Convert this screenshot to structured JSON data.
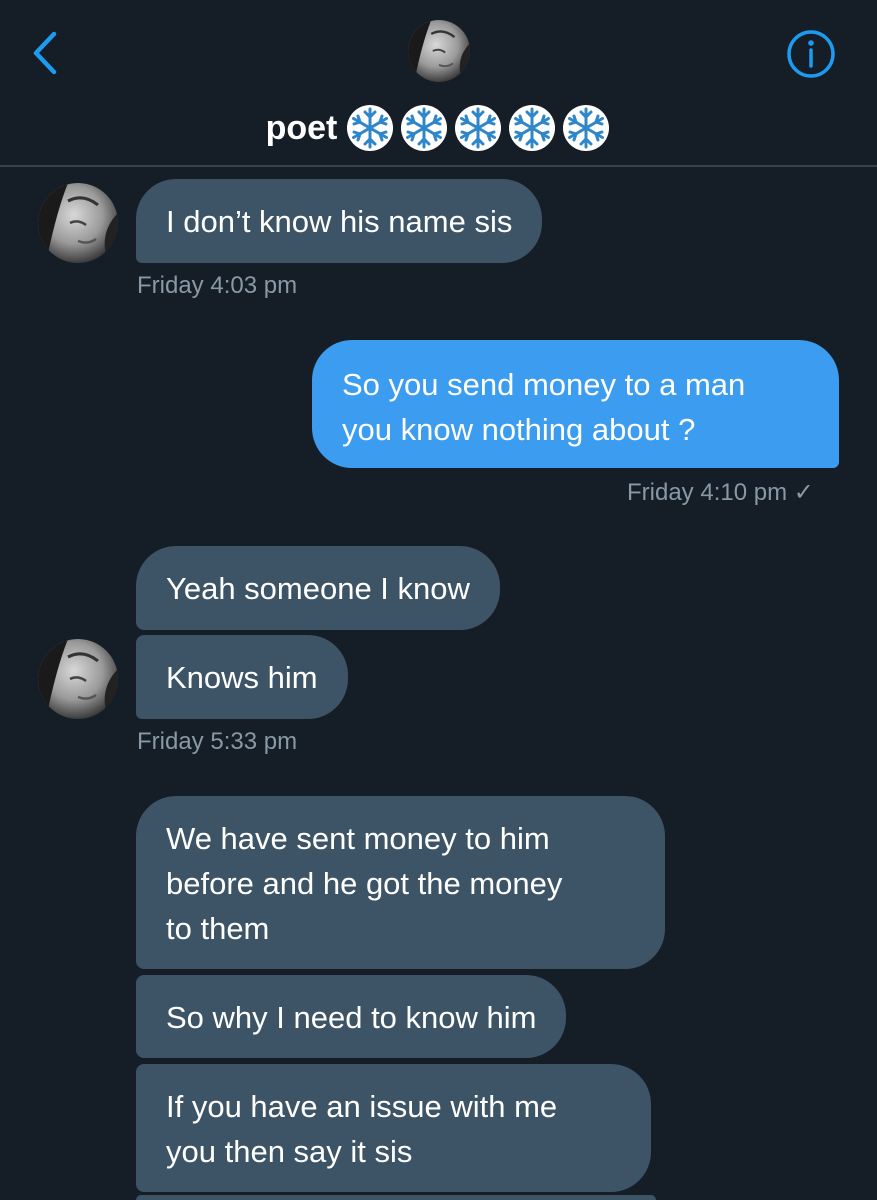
{
  "header": {
    "back_icon": "chevron-left-icon",
    "info_icon": "info-circle-icon",
    "contact_name": "poet",
    "name_emoji": [
      "❄️",
      "❄️",
      "❄️",
      "❄️",
      "❄️"
    ]
  },
  "messages": [
    {
      "direction": "incoming",
      "text": "I don’t know his name sis"
    },
    {
      "direction": "outgoing",
      "lines": [
        "So you send money to a man",
        "you know nothing about ?"
      ]
    },
    {
      "direction": "incoming",
      "text": "Yeah someone I know"
    },
    {
      "direction": "incoming",
      "text": "Knows him"
    },
    {
      "direction": "incoming",
      "lines": [
        "We have sent money to him",
        "before and he got the money",
        "to them"
      ]
    },
    {
      "direction": "incoming",
      "text": "So why I need to know him"
    },
    {
      "direction": "incoming",
      "lines": [
        "If you have an issue with me",
        "you then say it sis"
      ]
    }
  ],
  "timestamps": {
    "t1": "Friday 4:03 pm",
    "t2": "Friday 4:10 pm",
    "t2_read_mark": "✓",
    "t3": "Friday 5:33 pm"
  },
  "colors": {
    "background": "#151d27",
    "incoming_bubble": "#3d5466",
    "outgoing_bubble": "#3b9cf0",
    "accent": "#1d9bf0",
    "timestamp": "#8899a6"
  }
}
